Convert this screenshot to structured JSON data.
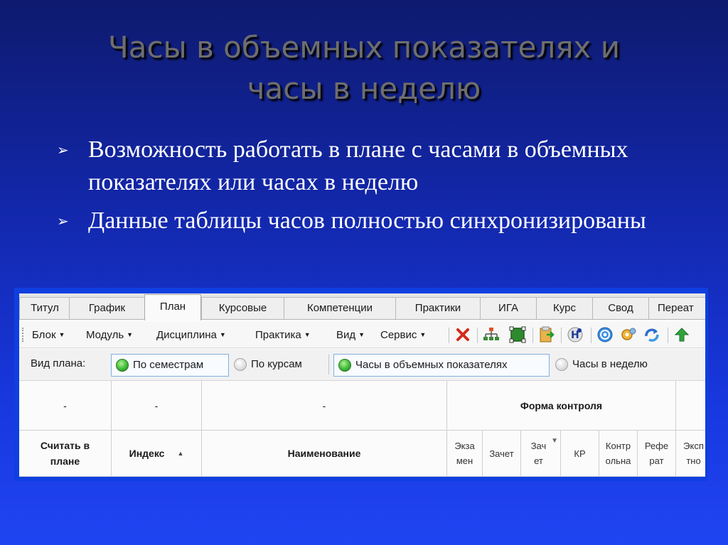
{
  "slide": {
    "title_line1": "Часы в объемных показателях и",
    "title_line2": "часы в неделю",
    "bullet_marker": "➢",
    "bullets": [
      "Возможность работать в плане с часами в объемных показателях или часах в неделю",
      "Данные таблицы часов полностью синхронизированы"
    ]
  },
  "app": {
    "tabs": [
      "Титул",
      "График",
      "План",
      "Курсовые",
      "Компетенции",
      "Практики",
      "ИГА",
      "Курс",
      "Свод",
      "Переат"
    ],
    "active_tab": "План",
    "menus": [
      "Блок",
      "Модуль",
      "Дисциплина",
      "Практика",
      "Вид",
      "Сервис"
    ],
    "toolbar_icons": [
      "delete-icon",
      "structure-icon",
      "select-cells-icon",
      "import-icon",
      "help-icon",
      "globe-icon",
      "settings-icon",
      "refresh-icon",
      "move-up-icon"
    ],
    "view_label": "Вид плана:",
    "plan_options": [
      {
        "label": "По семестрам",
        "selected": true
      },
      {
        "label": "По курсам",
        "selected": false
      }
    ],
    "hours_options": [
      {
        "label": "Часы в объемных показателях",
        "selected": true
      },
      {
        "label": "Часы в неделю",
        "selected": false
      }
    ],
    "grid": {
      "top_row": [
        "-",
        "-",
        "-"
      ],
      "group_header": "Форма контроля",
      "col_count_in_plan": "Считать в плане",
      "col_index": "Индекс",
      "sort_arrow": "▲",
      "col_name": "Наименование",
      "control_cols": [
        "Экза мен",
        "Зачет",
        "Зач ет",
        "КР",
        "Контр ольна",
        "Рефе рат",
        "Эксп тно"
      ],
      "filter_icon": "▼"
    }
  }
}
